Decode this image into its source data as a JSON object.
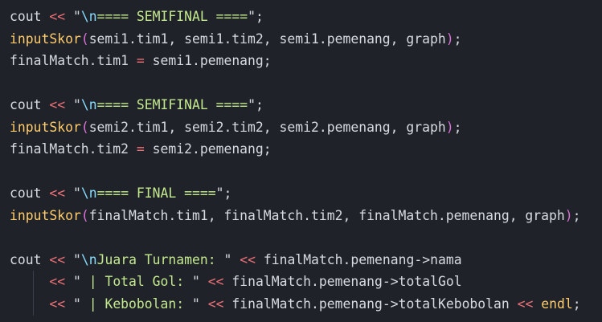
{
  "editor": {
    "colors": {
      "background": "#1f2329",
      "default": "#d7dae0",
      "operator": "#f07178",
      "string": "#c3e88d",
      "escape": "#89ddff",
      "function": "#ffcb6b",
      "paren_outer": "#ffd700",
      "paren_inner": "#da70d6",
      "identifier": "#d7dae0"
    },
    "lines": [
      [
        {
          "t": "cout ",
          "c": "identifier"
        },
        {
          "t": "<<",
          "c": "operator"
        },
        {
          "t": " \"",
          "c": "identifier"
        },
        {
          "t": "\\n",
          "c": "escape"
        },
        {
          "t": "==== SEMIFINAL ====",
          "c": "string"
        },
        {
          "t": "\";",
          "c": "identifier"
        }
      ],
      [
        {
          "t": "inputSkor",
          "c": "function"
        },
        {
          "t": "(",
          "c": "paren_inner"
        },
        {
          "t": "semi1.tim1, semi1.tim2, semi1.pemenang, graph",
          "c": "identifier"
        },
        {
          "t": ")",
          "c": "paren_inner"
        },
        {
          "t": ";",
          "c": "identifier"
        }
      ],
      [
        {
          "t": "finalMatch.tim1 ",
          "c": "identifier"
        },
        {
          "t": "=",
          "c": "operator"
        },
        {
          "t": " semi1.pemenang;",
          "c": "identifier"
        }
      ],
      [],
      [
        {
          "t": "cout ",
          "c": "identifier"
        },
        {
          "t": "<<",
          "c": "operator"
        },
        {
          "t": " \"",
          "c": "identifier"
        },
        {
          "t": "\\n",
          "c": "escape"
        },
        {
          "t": "==== SEMIFINAL ====",
          "c": "string"
        },
        {
          "t": "\";",
          "c": "identifier"
        }
      ],
      [
        {
          "t": "inputSkor",
          "c": "function"
        },
        {
          "t": "(",
          "c": "paren_inner"
        },
        {
          "t": "semi2.tim1, semi2.tim2, semi2.pemenang, graph",
          "c": "identifier"
        },
        {
          "t": ")",
          "c": "paren_inner"
        },
        {
          "t": ";",
          "c": "identifier"
        }
      ],
      [
        {
          "t": "finalMatch.tim2 ",
          "c": "identifier"
        },
        {
          "t": "=",
          "c": "operator"
        },
        {
          "t": " semi2.pemenang;",
          "c": "identifier"
        }
      ],
      [],
      [
        {
          "t": "cout ",
          "c": "identifier"
        },
        {
          "t": "<<",
          "c": "operator"
        },
        {
          "t": " \"",
          "c": "identifier"
        },
        {
          "t": "\\n",
          "c": "escape"
        },
        {
          "t": "==== FINAL ====",
          "c": "string"
        },
        {
          "t": "\";",
          "c": "identifier"
        }
      ],
      [
        {
          "t": "inputSkor",
          "c": "function"
        },
        {
          "t": "(",
          "c": "paren_inner"
        },
        {
          "t": "finalMatch.tim1, finalMatch.tim2, finalMatch.pemenang, graph",
          "c": "identifier"
        },
        {
          "t": ")",
          "c": "paren_inner"
        },
        {
          "t": ";",
          "c": "identifier"
        }
      ],
      [],
      [
        {
          "t": "cout ",
          "c": "identifier"
        },
        {
          "t": "<<",
          "c": "operator"
        },
        {
          "t": " \"",
          "c": "identifier"
        },
        {
          "t": "\\n",
          "c": "escape"
        },
        {
          "t": "Juara Turnamen: ",
          "c": "string"
        },
        {
          "t": "\" ",
          "c": "identifier"
        },
        {
          "t": "<<",
          "c": "operator"
        },
        {
          "t": " finalMatch.pemenang",
          "c": "identifier"
        },
        {
          "t": "->",
          "c": "identifier"
        },
        {
          "t": "nama",
          "c": "identifier"
        }
      ],
      [
        {
          "t": "     ",
          "c": "identifier"
        },
        {
          "t": "<<",
          "c": "operator"
        },
        {
          "t": " \"",
          "c": "identifier"
        },
        {
          "t": " | Total Gol: ",
          "c": "string"
        },
        {
          "t": "\" ",
          "c": "identifier"
        },
        {
          "t": "<<",
          "c": "operator"
        },
        {
          "t": " finalMatch.pemenang",
          "c": "identifier"
        },
        {
          "t": "->",
          "c": "identifier"
        },
        {
          "t": "totalGol",
          "c": "identifier"
        }
      ],
      [
        {
          "t": "     ",
          "c": "identifier"
        },
        {
          "t": "<<",
          "c": "operator"
        },
        {
          "t": " \"",
          "c": "identifier"
        },
        {
          "t": " | Kebobolan: ",
          "c": "string"
        },
        {
          "t": "\" ",
          "c": "identifier"
        },
        {
          "t": "<<",
          "c": "operator"
        },
        {
          "t": " finalMatch.pemenang",
          "c": "identifier"
        },
        {
          "t": "->",
          "c": "identifier"
        },
        {
          "t": "totalKebobolan ",
          "c": "identifier"
        },
        {
          "t": "<<",
          "c": "operator"
        },
        {
          "t": " ",
          "c": "identifier"
        },
        {
          "t": "endl",
          "c": "function"
        },
        {
          "t": ";",
          "c": "identifier"
        }
      ]
    ]
  }
}
